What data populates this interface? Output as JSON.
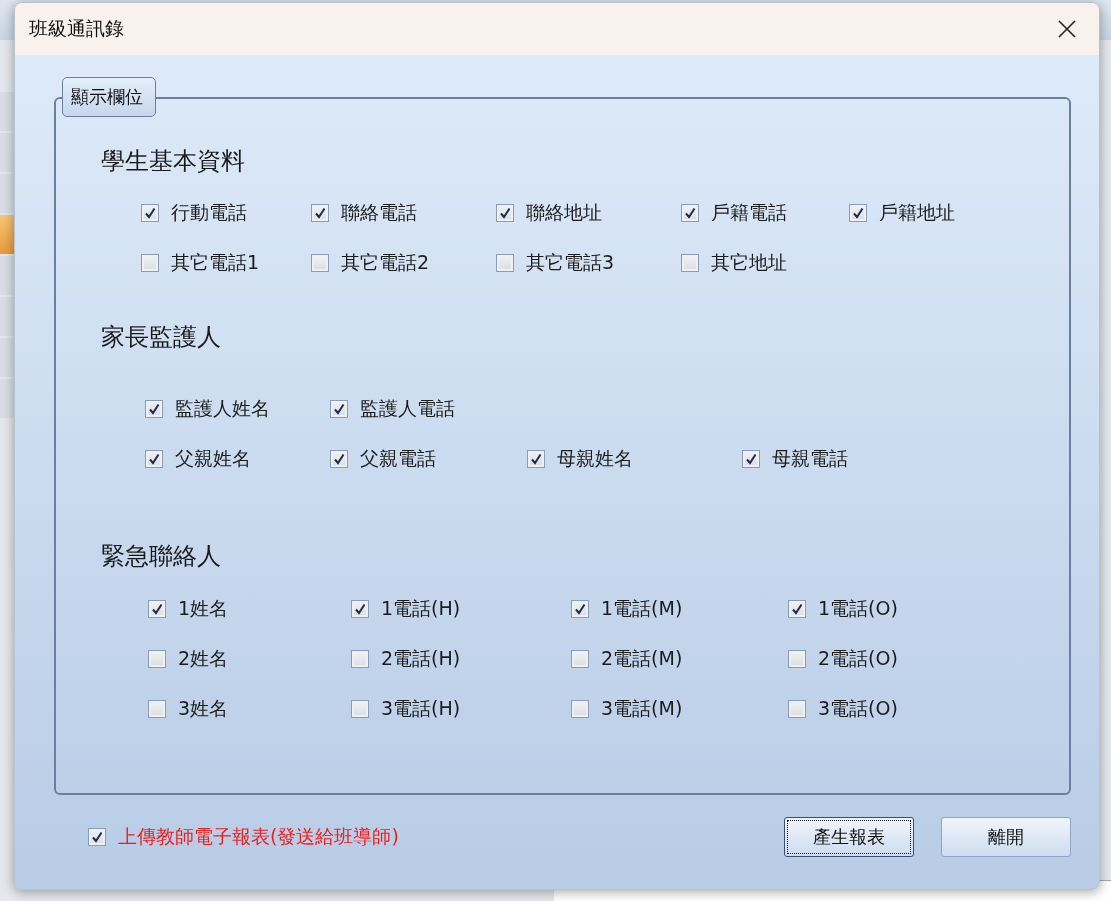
{
  "background": {
    "side_list": [
      {
        "selected": false
      },
      {
        "selected": false
      },
      {
        "selected": false
      },
      {
        "selected": true
      },
      {
        "selected": false
      },
      {
        "selected": false
      },
      {
        "selected": false
      },
      {
        "selected": false
      }
    ]
  },
  "dialog": {
    "title": "班級通訊錄",
    "group": {
      "legend": "顯示欄位",
      "sections": [
        {
          "kind": "student",
          "heading": "學生基本資料",
          "rows": [
            [
              {
                "label": "行動電話",
                "checked": true
              },
              {
                "label": "聯絡電話",
                "checked": true
              },
              {
                "label": "聯絡地址",
                "checked": true
              },
              {
                "label": "戶籍電話",
                "checked": true
              },
              {
                "label": "戶籍地址",
                "checked": true
              }
            ],
            [
              {
                "label": "其它電話1",
                "checked": false
              },
              {
                "label": "其它電話2",
                "checked": false
              },
              {
                "label": "其它電話3",
                "checked": false
              },
              {
                "label": "其它地址",
                "checked": false
              }
            ]
          ]
        },
        {
          "kind": "guardian",
          "heading": "家長監護人",
          "rows": [
            [
              {
                "label": "監護人姓名",
                "checked": true
              },
              {
                "label": "監護人電話",
                "checked": true
              }
            ],
            [
              {
                "label": "父親姓名",
                "checked": true
              },
              {
                "label": "父親電話",
                "checked": true
              },
              {
                "label": "母親姓名",
                "checked": true
              },
              {
                "label": "母親電話",
                "checked": true
              }
            ]
          ]
        },
        {
          "kind": "emergency",
          "heading": "緊急聯絡人",
          "rows": [
            [
              {
                "label": "1姓名",
                "checked": true
              },
              {
                "label": "1電話(H)",
                "checked": true
              },
              {
                "label": "1電話(M)",
                "checked": true
              },
              {
                "label": "1電話(O)",
                "checked": true
              }
            ],
            [
              {
                "label": "2姓名",
                "checked": false
              },
              {
                "label": "2電話(H)",
                "checked": false
              },
              {
                "label": "2電話(M)",
                "checked": false
              },
              {
                "label": "2電話(O)",
                "checked": false
              }
            ],
            [
              {
                "label": "3姓名",
                "checked": false
              },
              {
                "label": "3電話(H)",
                "checked": false
              },
              {
                "label": "3電話(M)",
                "checked": false
              },
              {
                "label": "3電話(O)",
                "checked": false
              }
            ]
          ]
        }
      ]
    },
    "upload": {
      "label": "上傳教師電子報表(發送給班導師)",
      "checked": true
    },
    "buttons": [
      {
        "label": "產生報表",
        "focused": true
      },
      {
        "label": "離開",
        "focused": false
      }
    ]
  }
}
